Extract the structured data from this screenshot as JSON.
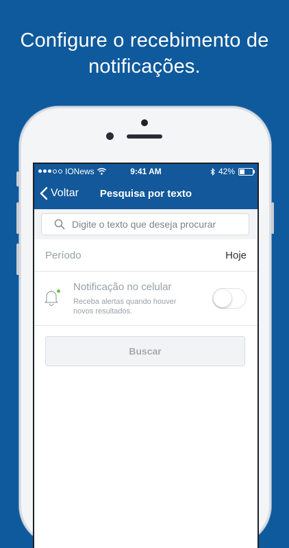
{
  "headline": {
    "line1": "Configure o recebimento de",
    "line2": "notificações."
  },
  "status_bar": {
    "carrier": "IONews",
    "time": "9:41 AM",
    "battery": "42%",
    "battery_level": 0.42
  },
  "nav": {
    "back_label": "Voltar",
    "title": "Pesquisa por texto"
  },
  "search": {
    "placeholder": "Digite o texto que deseja procurar",
    "value": ""
  },
  "period": {
    "label": "Período",
    "value": "Hoje"
  },
  "notification": {
    "title": "Notificação no celular",
    "subtitle_line1": "Receba alertas quando houver",
    "subtitle_line2": "novos resultados.",
    "enabled": false
  },
  "search_button": {
    "label": "Buscar"
  },
  "colors": {
    "brand": "#12589a",
    "background": "#0f5a9c",
    "indicator": "#6bc04b"
  },
  "icons": [
    "back-chevron-icon",
    "search-icon",
    "bell-icon",
    "wifi-icon",
    "bluetooth-icon",
    "battery-icon"
  ]
}
